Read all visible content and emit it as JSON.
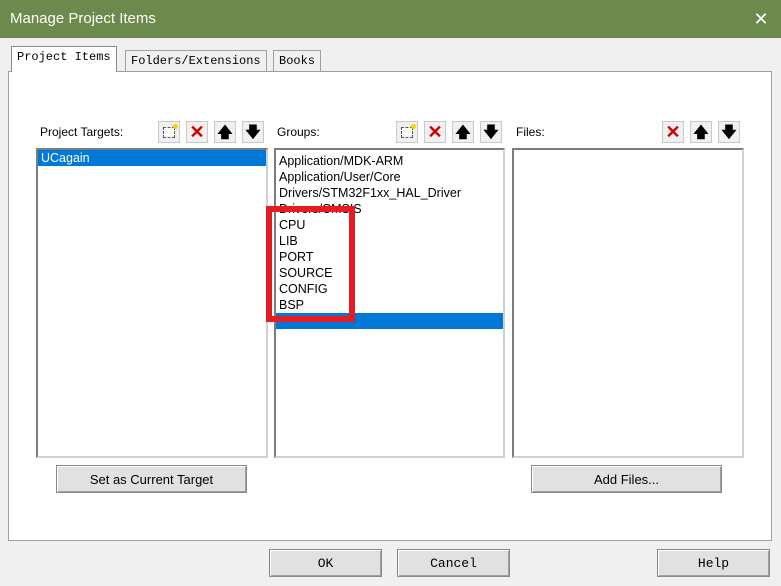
{
  "window": {
    "title": "Manage Project Items",
    "close_glyph": "✕"
  },
  "tabs": [
    {
      "label": "Project Items"
    },
    {
      "label": "Folders/Extensions"
    },
    {
      "label": "Books"
    }
  ],
  "targets": {
    "label": "Project Targets:",
    "items": [
      "UCagain"
    ],
    "set_current_label": "Set as Current Target"
  },
  "groups": {
    "label": "Groups:",
    "items": [
      "Application/MDK-ARM",
      "Application/User/Core",
      "Drivers/STM32F1xx_HAL_Driver",
      "Drivers/CMSIS",
      "CPU",
      "LIB",
      "PORT",
      "SOURCE",
      "CONFIG",
      "BSP",
      ""
    ]
  },
  "files": {
    "label": "Files:",
    "add_files_label": "Add Files..."
  },
  "toolbar_icons": {
    "new": "new-item-icon",
    "delete": "delete-x-icon",
    "up": "move-up-icon",
    "down": "move-down-icon"
  },
  "glyphs": {
    "delete": "✕",
    "up": "🡅",
    "down": "🡇"
  },
  "footer": {
    "ok_label": "OK",
    "cancel_label": "Cancel",
    "help_label": "Help"
  },
  "colors": {
    "titlebar": "#6b8a4b",
    "selection": "#0078d7",
    "highlight": "#e51c23",
    "delete": "#d00000"
  }
}
